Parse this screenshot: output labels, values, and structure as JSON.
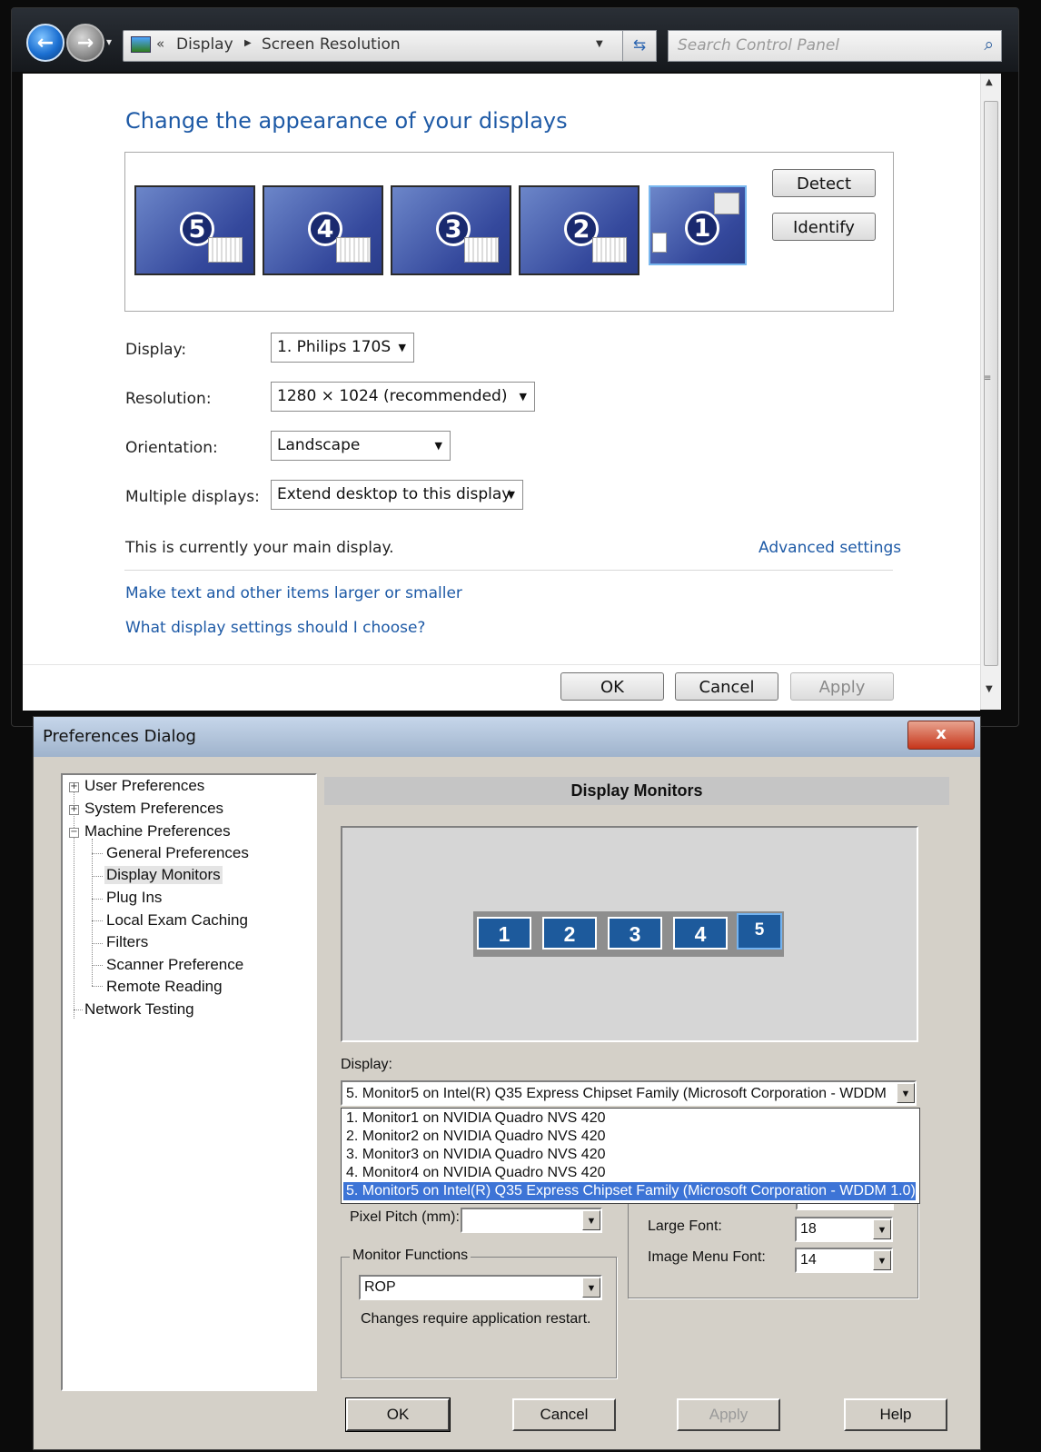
{
  "screen_res": {
    "address": {
      "crumb1": "Display",
      "crumb2": "Screen Resolution",
      "search_placeholder": "Search Control Panel"
    },
    "heading": "Change the appearance of your displays",
    "monitors": [
      "5",
      "4",
      "3",
      "2",
      "1"
    ],
    "detect_label": "Detect",
    "identify_label": "Identify",
    "fields": {
      "display_label": "Display:",
      "display_value": "1. Philips 170S",
      "resolution_label": "Resolution:",
      "resolution_value": "1280 × 1024 (recommended)",
      "orientation_label": "Orientation:",
      "orientation_value": "Landscape",
      "multi_label": "Multiple displays:",
      "multi_value": "Extend desktop to this display"
    },
    "main_display_text": "This is currently your main display.",
    "advanced_link": "Advanced settings",
    "link1": "Make text and other items larger or smaller",
    "link2": "What display settings should I choose?",
    "buttons": {
      "ok": "OK",
      "cancel": "Cancel",
      "apply": "Apply"
    }
  },
  "prefs": {
    "title": "Preferences Dialog",
    "close_glyph": "x",
    "tree": {
      "user": "User Preferences",
      "system": "System Preferences",
      "machine": "Machine Preferences",
      "children": [
        "General Preferences",
        "Display Monitors",
        "Plug Ins",
        "Local Exam Caching",
        "Filters",
        "Scanner Preference",
        "Remote Reading"
      ],
      "network": "Network Testing"
    },
    "section_title": "Display Monitors",
    "arrangement": [
      "1",
      "2",
      "3",
      "4",
      "5"
    ],
    "display_label": "Display:",
    "display_selected": "5. Monitor5 on Intel(R) Q35 Express Chipset Family (Microsoft Corporation - WDDM",
    "display_options": [
      "1. Monitor1 on NVIDIA Quadro NVS 420",
      "2. Monitor2 on NVIDIA Quadro NVS 420",
      "3. Monitor3 on NVIDIA Quadro NVS 420",
      "4. Monitor4 on NVIDIA Quadro NVS 420",
      "5. Monitor5 on Intel(R) Q35 Express Chipset Family (Microsoft Corporation - WDDM 1.0)"
    ],
    "pixel_pitch_label": "Pixel Pitch (mm):",
    "pixel_pitch_value": "",
    "large_font_label": "Large Font:",
    "large_font_value": "18",
    "image_menu_font_label": "Image Menu Font:",
    "image_menu_font_value": "14",
    "monitor_functions_label": "Monitor Functions",
    "monitor_functions_value": "ROP",
    "restart_note": "Changes require application restart.",
    "buttons": {
      "ok": "OK",
      "cancel": "Cancel",
      "apply": "Apply",
      "help": "Help"
    }
  }
}
